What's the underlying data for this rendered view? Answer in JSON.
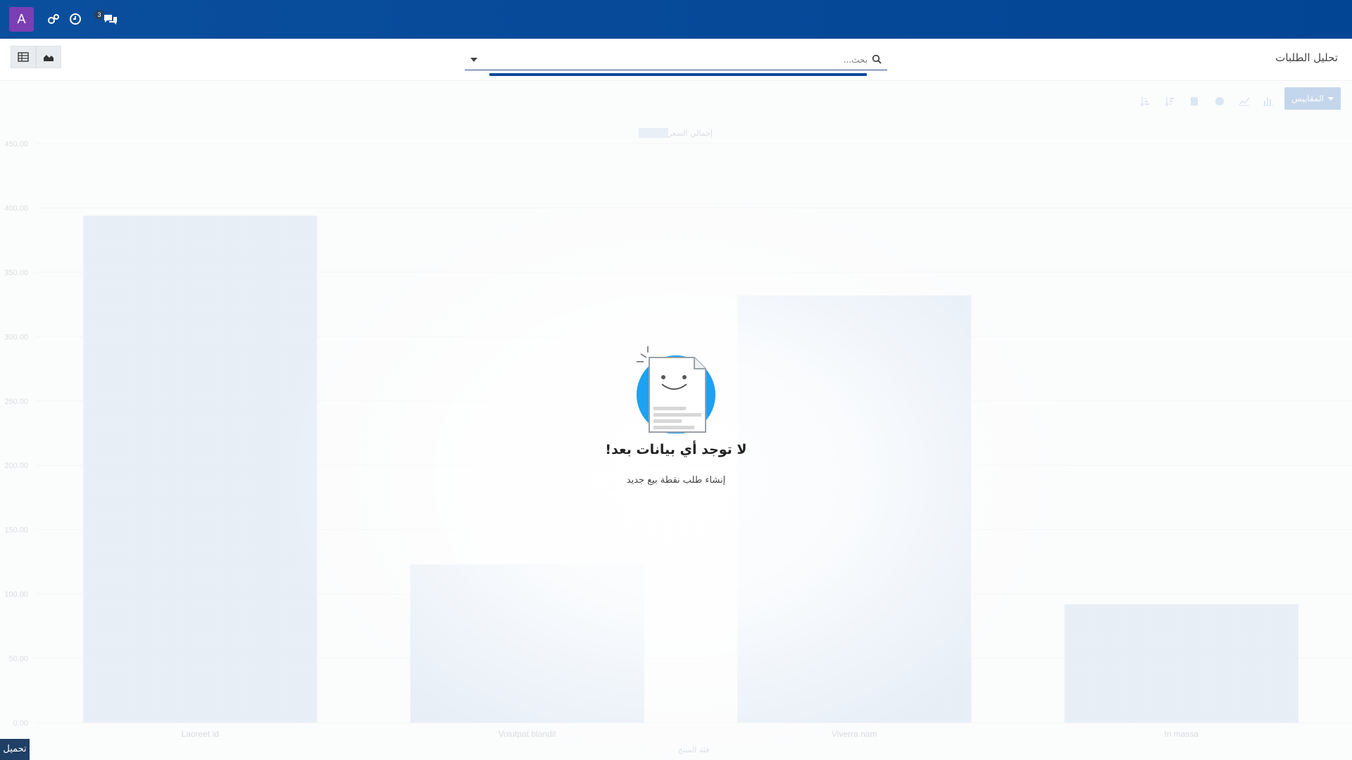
{
  "navbar": {
    "avatar_letter": "A",
    "messages_badge": "3",
    "accent": "#0a4e9e"
  },
  "control_panel": {
    "breadcrumb": "تحليل الطلبات",
    "search_placeholder": "بحث...",
    "views": [
      "graph-view",
      "pivot-view"
    ]
  },
  "toolbar": {
    "measures_label": "المقاييس",
    "icons": [
      "bar-chart-icon",
      "line-chart-icon",
      "pie-chart-icon",
      "database-icon",
      "sort-descending-icon",
      "sort-ascending-icon"
    ]
  },
  "chart_data": {
    "type": "bar",
    "categories": [
      "Laoreet id",
      "Volutpat blandit",
      "Viverra nam",
      "In massa"
    ],
    "series": [
      {
        "name": "إجمالي السعر",
        "values": [
          394,
          123,
          332,
          92
        ]
      }
    ],
    "ylim": [
      0,
      450
    ],
    "yticks": [
      "0.00",
      "50.00",
      "100.00",
      "150.00",
      "200.00",
      "250.00",
      "300.00",
      "350.00",
      "400.00",
      "450.00"
    ],
    "xlabel": "فئة المنتج",
    "ylabel": "",
    "legend_position": "top-center",
    "bar_color": "#dbe6f3"
  },
  "empty_state": {
    "title": "لا توجد أي بيانات بعد!",
    "subtitle": "إنشاء طلب نقطة بيع جديد"
  },
  "footer": {
    "download_label": "تحميل"
  }
}
